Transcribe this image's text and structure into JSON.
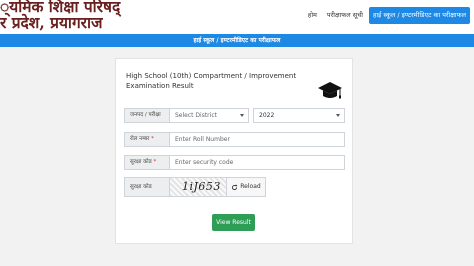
{
  "header": {
    "title_line1": "्यमिक शिक्षा परिषद्",
    "title_line2": "र प्रदेश, प्रयागराज"
  },
  "nav": {
    "items": [
      {
        "label": "होम"
      },
      {
        "label": "परीक्षाफल सूची"
      },
      {
        "label": "हाई स्कूल / इण्टरमीडिएट का परीक्षाफल"
      }
    ]
  },
  "banner": {
    "text": "हाई स्कूल / इण्टरमीडिएट का परीक्षाफल"
  },
  "form": {
    "title_line1": "High School (10th) Compartment / Improvement",
    "title_line2": "Examination Result",
    "district_label": "जनपद / परीक्षा",
    "district_placeholder": "Select District",
    "year_value": "2022",
    "roll_label": "रोल नम्बर",
    "roll_placeholder": "Enter Roll Number",
    "security_label": "सुरक्षा कोड",
    "security_placeholder": "Enter security code",
    "captcha_label": "सुरक्षा कोड",
    "captcha_text": "1iJ653",
    "reload_label": "Reload",
    "submit_label": "View Result",
    "required_mark": "*"
  },
  "colors": {
    "accent": "#1e88e5",
    "submit": "#2e9e57",
    "title": "#6b2020"
  },
  "icons": [
    "graduation-cap-icon",
    "reload-icon",
    "chevron-down-icon"
  ]
}
